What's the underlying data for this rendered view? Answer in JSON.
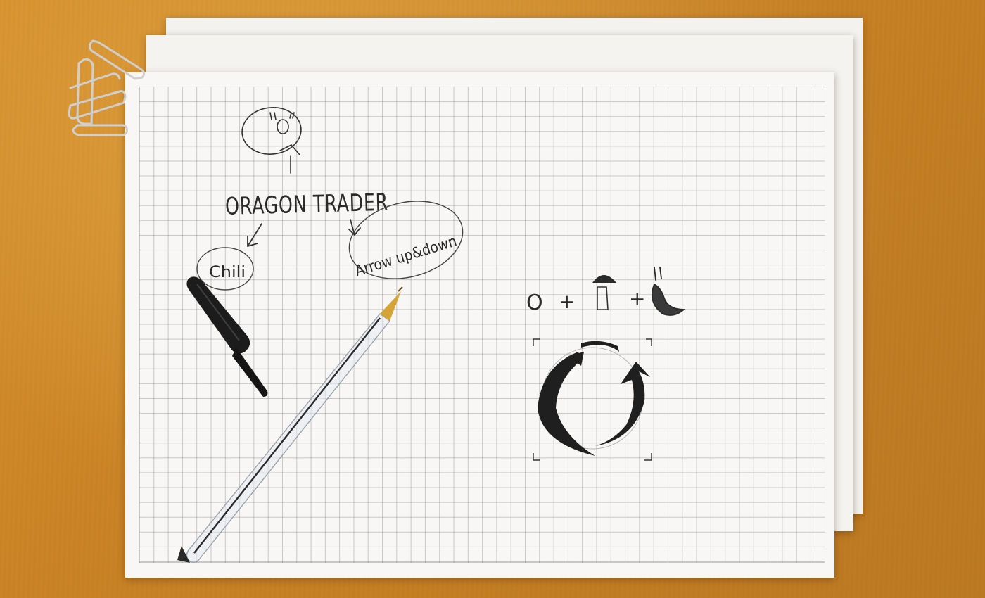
{
  "sketch": {
    "title": "ORAGON TRADER",
    "label_left": "Chili",
    "label_right": "Arrow up&down",
    "equation": {
      "term1": "O",
      "plus": "+"
    }
  },
  "colors": {
    "desk": "#c98226",
    "paper": "#f8f7f5",
    "grid": "#9a9a9a",
    "ink": "#2a2a2a",
    "pen_cap": "#1c1c1c",
    "pen_tip": "#d4a437",
    "clip": "#c8c8c8"
  },
  "objects": [
    "paper-clips-icon",
    "pen-cap-icon",
    "ballpoint-pen-icon",
    "refresh-arrows-icon",
    "face-sketch-icon",
    "mushroom-icon",
    "chili-icon"
  ]
}
